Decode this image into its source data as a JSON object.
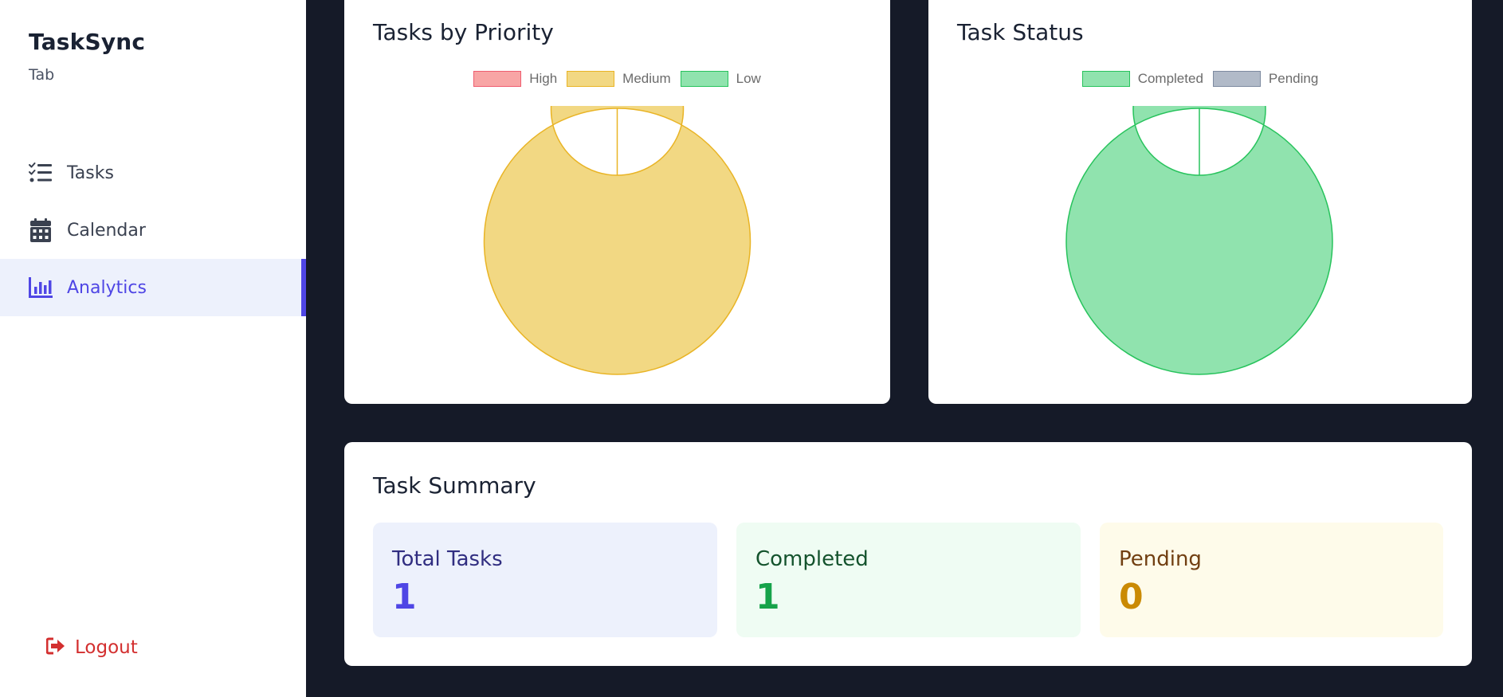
{
  "app": {
    "title": "TaskSync",
    "subtitle": "Tab"
  },
  "sidebar": {
    "items": [
      {
        "label": "Tasks",
        "icon": "task-list-icon",
        "active": false
      },
      {
        "label": "Calendar",
        "icon": "calendar-icon",
        "active": false
      },
      {
        "label": "Analytics",
        "icon": "bar-chart-icon",
        "active": true
      }
    ],
    "logout_label": "Logout"
  },
  "charts": {
    "priority": {
      "title": "Tasks by Priority",
      "legend": [
        {
          "label": "High",
          "fill": "#f8a5a5",
          "stroke": "#ef5d6f"
        },
        {
          "label": "Medium",
          "fill": "#f2d883",
          "stroke": "#e9b425"
        },
        {
          "label": "Low",
          "fill": "#90e3ae",
          "stroke": "#27c35c"
        }
      ]
    },
    "status": {
      "title": "Task Status",
      "legend": [
        {
          "label": "Completed",
          "fill": "#90e3ae",
          "stroke": "#27c35c"
        },
        {
          "label": "Pending",
          "fill": "#b1bac8",
          "stroke": "#7d8aa0"
        }
      ]
    }
  },
  "chart_data": [
    {
      "type": "pie",
      "title": "Tasks by Priority",
      "categories": [
        "High",
        "Medium",
        "Low"
      ],
      "values": [
        0,
        1,
        0
      ],
      "colors": [
        "#f8a5a5",
        "#f2d883",
        "#90e3ae"
      ],
      "strokes": [
        "#ef5d6f",
        "#e9b425",
        "#27c35c"
      ],
      "legend": "top"
    },
    {
      "type": "pie",
      "title": "Task Status",
      "categories": [
        "Completed",
        "Pending"
      ],
      "values": [
        1,
        0
      ],
      "colors": [
        "#90e3ae",
        "#b1bac8"
      ],
      "strokes": [
        "#27c35c",
        "#7d8aa0"
      ],
      "legend": "top"
    }
  ],
  "summary": {
    "title": "Task Summary",
    "stats": [
      {
        "label": "Total Tasks",
        "value": "1",
        "bg": "#edf1fc",
        "label_color": "#312e81",
        "value_color": "#4f46e5"
      },
      {
        "label": "Completed",
        "value": "1",
        "bg": "#effcf3",
        "label_color": "#14532d",
        "value_color": "#16a34a"
      },
      {
        "label": "Pending",
        "value": "0",
        "bg": "#fefbea",
        "label_color": "#713f12",
        "value_color": "#ca8a04"
      }
    ]
  }
}
